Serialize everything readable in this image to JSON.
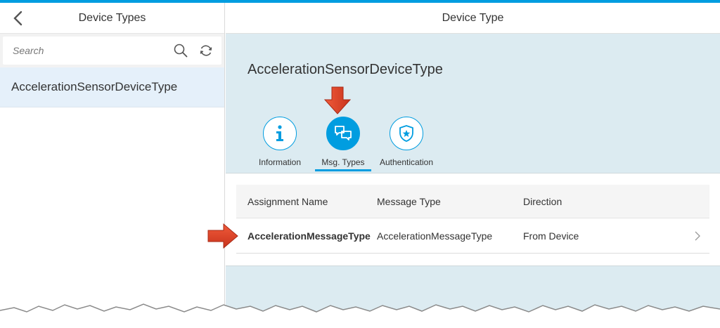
{
  "colors": {
    "accent": "#009de0",
    "arrow": "#e0412b",
    "detail_bg": "#dcebf1",
    "selected_item": "#e5f0fa"
  },
  "master": {
    "title": "Device Types",
    "back_icon": "chevron-left-icon",
    "search": {
      "placeholder": "Search",
      "value": ""
    },
    "list": [
      {
        "label": "AccelerationSensorDeviceType"
      }
    ]
  },
  "detail": {
    "title": "Device Type",
    "object_title": "AccelerationSensorDeviceType",
    "tabs": [
      {
        "label": "Information",
        "icon": "info-icon",
        "selected": false
      },
      {
        "label": "Msg. Types",
        "icon": "messages-icon",
        "selected": true
      },
      {
        "label": "Authentication",
        "icon": "badge-icon",
        "selected": false
      }
    ],
    "table": {
      "headers": [
        "Assignment Name",
        "Message Type",
        "Direction"
      ],
      "rows": [
        [
          "AccelerationMessageType",
          "AccelerationMessageType",
          "From Device"
        ]
      ]
    }
  }
}
